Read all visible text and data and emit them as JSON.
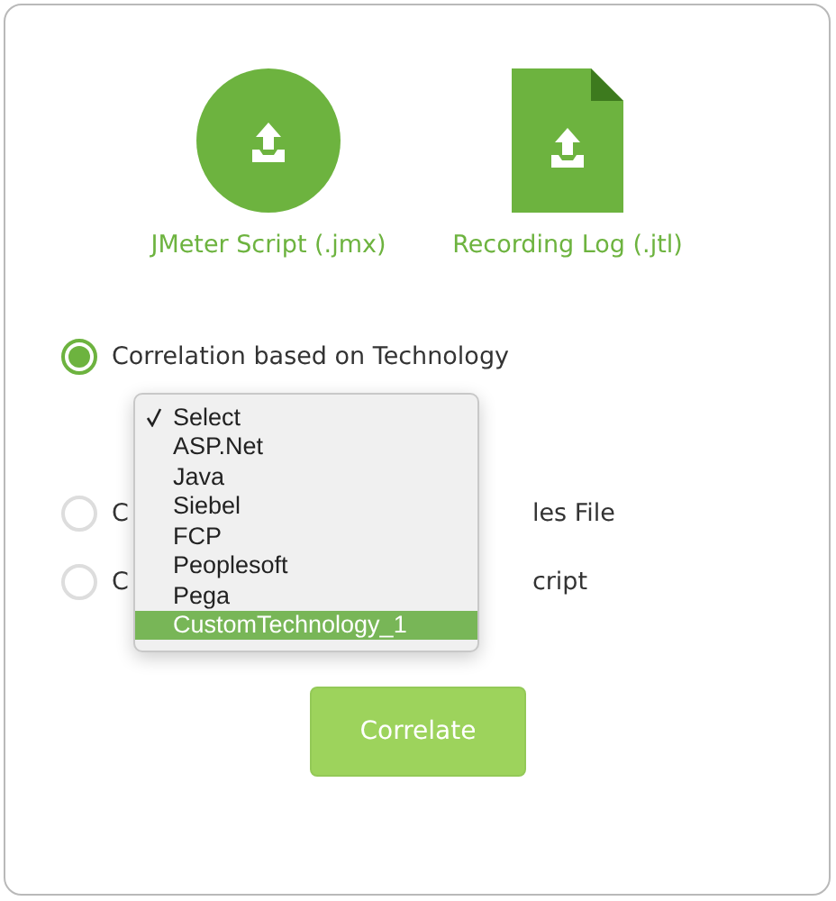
{
  "uploads": [
    {
      "kind": "circle",
      "label": "JMeter Script (.jmx)"
    },
    {
      "kind": "file",
      "label": "Recording Log (.jtl)"
    }
  ],
  "options": [
    {
      "label_parts": [
        "Correlation based on Technology"
      ],
      "selected": true
    },
    {
      "label_parts": [
        "C",
        "les File"
      ],
      "selected": false
    },
    {
      "label_parts": [
        "C",
        "cript"
      ],
      "selected": false
    }
  ],
  "menu": {
    "items": [
      {
        "label": "Select",
        "checked": true,
        "highlighted": false
      },
      {
        "label": "ASP.Net",
        "checked": false,
        "highlighted": false
      },
      {
        "label": "Java",
        "checked": false,
        "highlighted": false
      },
      {
        "label": "Siebel",
        "checked": false,
        "highlighted": false
      },
      {
        "label": "FCP",
        "checked": false,
        "highlighted": false
      },
      {
        "label": "Peoplesoft",
        "checked": false,
        "highlighted": false
      },
      {
        "label": "Pega",
        "checked": false,
        "highlighted": false
      },
      {
        "label": "CustomTechnology_1",
        "checked": false,
        "highlighted": true
      }
    ]
  },
  "button": "Correlate"
}
